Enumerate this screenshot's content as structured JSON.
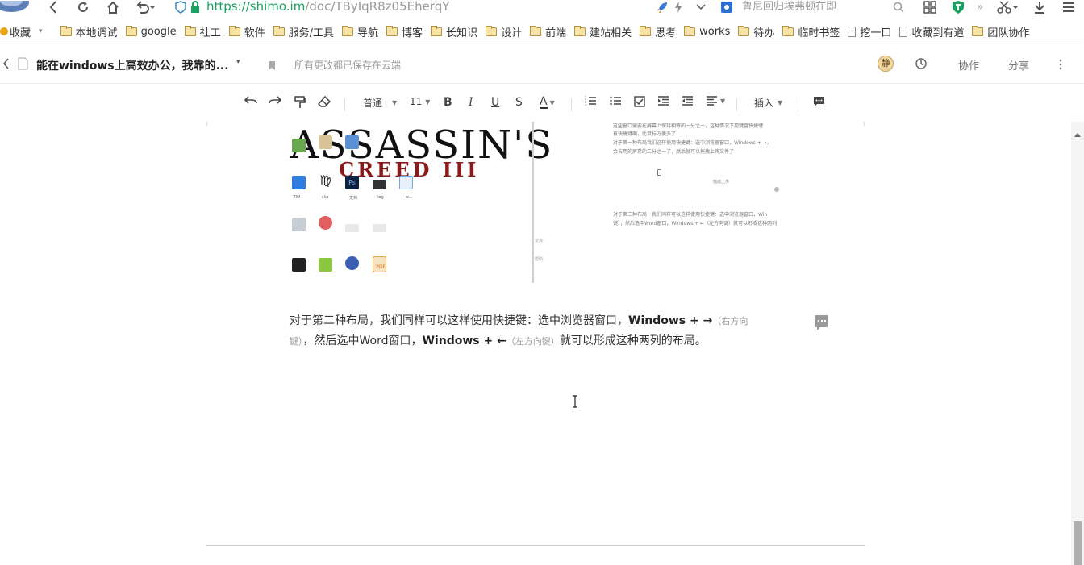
{
  "browser": {
    "url_host": "https://shimo.im",
    "url_path": "/doc/TByIqR8z05EherqY",
    "search_text": "鲁尼回归埃弗顿在即",
    "bookmarks_label": "收藏",
    "bookmarks": [
      {
        "label": "本地调试",
        "type": "folder"
      },
      {
        "label": "google",
        "type": "folder"
      },
      {
        "label": "社工",
        "type": "folder"
      },
      {
        "label": "软件",
        "type": "folder"
      },
      {
        "label": "服务/工具",
        "type": "folder"
      },
      {
        "label": "导航",
        "type": "folder"
      },
      {
        "label": "博客",
        "type": "folder"
      },
      {
        "label": "长知识",
        "type": "folder"
      },
      {
        "label": "设计",
        "type": "folder"
      },
      {
        "label": "前端",
        "type": "folder"
      },
      {
        "label": "建站相关",
        "type": "folder"
      },
      {
        "label": "思考",
        "type": "folder"
      },
      {
        "label": "works",
        "type": "folder"
      },
      {
        "label": "待办",
        "type": "folder"
      },
      {
        "label": "临时书签",
        "type": "folder"
      },
      {
        "label": "挖一口",
        "type": "page"
      },
      {
        "label": "收藏到有道",
        "type": "page"
      },
      {
        "label": "团队协作",
        "type": "folder"
      }
    ]
  },
  "doc": {
    "title": "能在windows上高效办公，我靠的...",
    "save_status": "所有更改都已保存在云端",
    "avatar_text": "静",
    "collab_label": "协作",
    "share_label": "分享"
  },
  "toolbar": {
    "style_label": "普通",
    "size_label": "11",
    "bold": "B",
    "italic": "I",
    "underline": "U",
    "strike": "S",
    "color": "A",
    "insert_label": "插入"
  },
  "screenshot": {
    "game_title": "ASSASSIN'S",
    "game_subtitle": "CREED III",
    "right_text_lines": [
      "这些窗口需要在屏幕上保持相等的一分之一，这种情况下用键盘快捷键",
      "有快捷键啊，比鼠标方便多了！",
      "对于第一种布局我们这样使用快捷键：选中浏览器窗口，Windows + →，",
      "会占用的屏幕的二分之一了，然后就可以拖拽上传文件了"
    ],
    "upload_label": "拖动上传",
    "lower_text_lines": [
      "对于第二种布局，我们同样可以这样使用快捷键：选中浏览器窗口，Win",
      "键），然后选中Word窗口，Windows + ←（左方向键）就可以形成这种两列"
    ],
    "side_labels": [
      "交流",
      "帮助"
    ]
  },
  "paragraph": {
    "part1": "对于第二种布局，我们同样可以这样使用快捷键：选中浏览器窗口，",
    "key1": "Windows + →",
    "hint1a": "（右方向",
    "hint1b": "键）",
    "part2": "，然后选中Word窗口，",
    "key2": "Windows + ←",
    "hint2": "（左方向键）",
    "part3": "就可以形成这种两列的布局。"
  }
}
